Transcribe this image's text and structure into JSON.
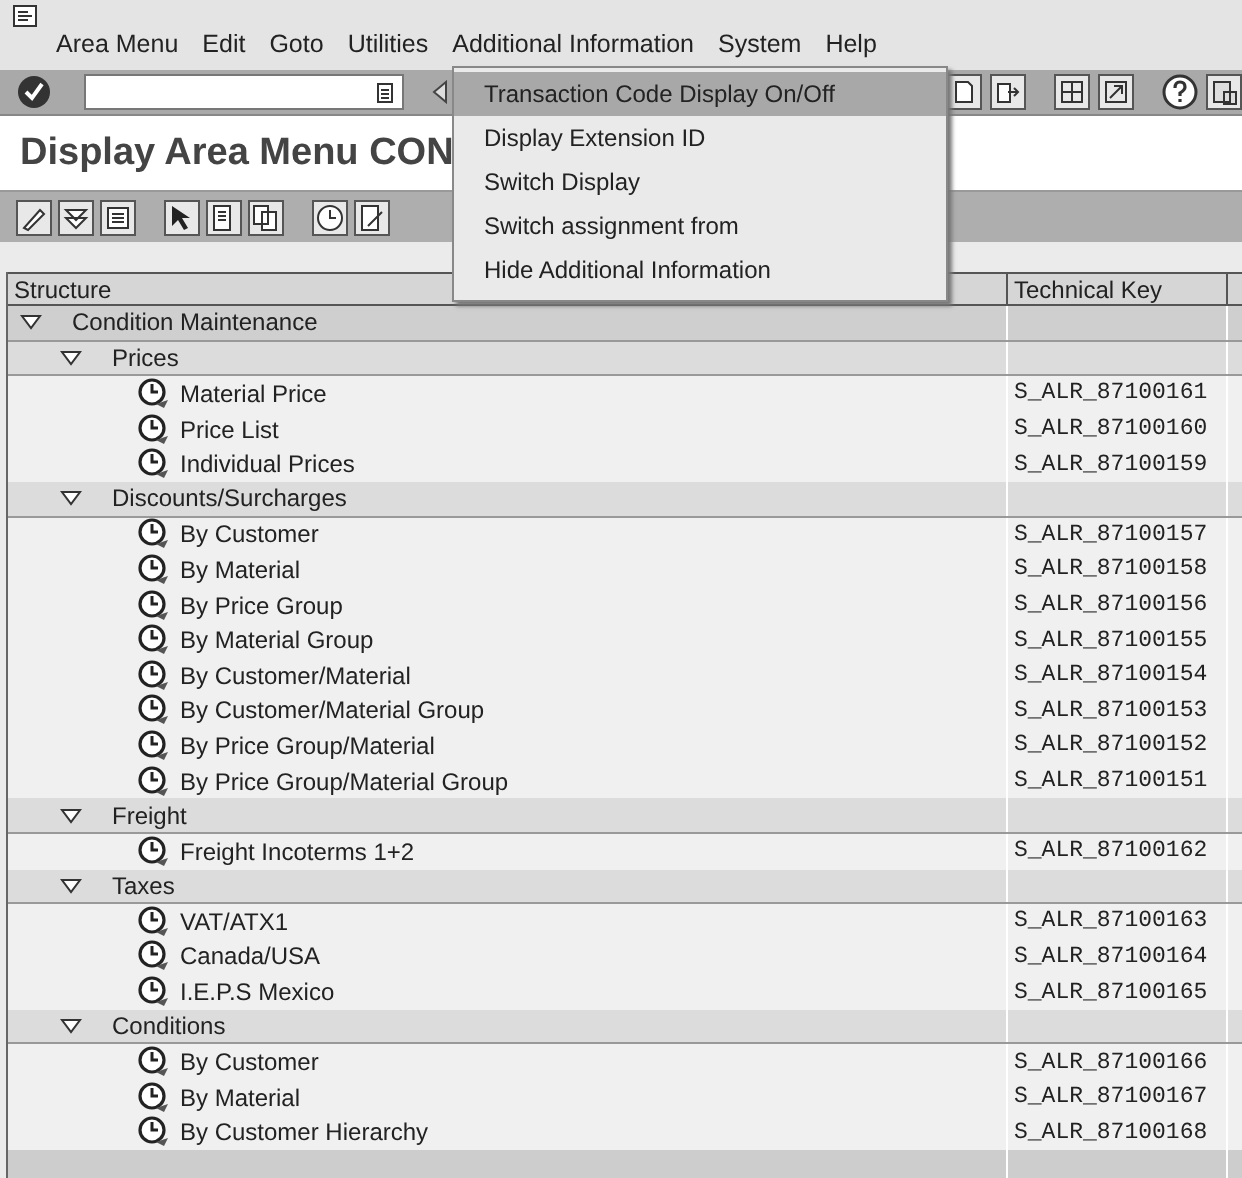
{
  "menu_bar": {
    "items": [
      {
        "label": "Area Menu"
      },
      {
        "label": "Edit"
      },
      {
        "label": "Goto"
      },
      {
        "label": "Utilities"
      },
      {
        "label": "Additional Information"
      },
      {
        "label": "System"
      },
      {
        "label": "Help"
      }
    ]
  },
  "title": "Display Area Menu CON",
  "dropdown": {
    "items": [
      {
        "label": "Transaction Code Display On/Off",
        "selected": true
      },
      {
        "label": "Display Extension ID",
        "selected": false
      },
      {
        "label": "Switch Display",
        "selected": false
      },
      {
        "label": "Switch assignment from",
        "selected": false
      },
      {
        "label": "Hide Additional Information",
        "selected": false
      }
    ]
  },
  "table": {
    "columns": [
      "Structure",
      "Technical Key"
    ],
    "rows": [
      {
        "label": "Condition Maintenance",
        "expanded": true,
        "children": [
          {
            "label": "Prices",
            "expanded": true,
            "children": [
              {
                "label": "Material Price",
                "technical_key": "S_ALR_87100161"
              },
              {
                "label": "Price List",
                "technical_key": "S_ALR_87100160"
              },
              {
                "label": "Individual Prices",
                "technical_key": "S_ALR_87100159"
              }
            ]
          },
          {
            "label": "Discounts/Surcharges",
            "expanded": true,
            "children": [
              {
                "label": "By Customer",
                "technical_key": "S_ALR_87100157"
              },
              {
                "label": "By Material",
                "technical_key": "S_ALR_87100158"
              },
              {
                "label": "By Price Group",
                "technical_key": "S_ALR_87100156"
              },
              {
                "label": "By Material Group",
                "technical_key": "S_ALR_87100155"
              },
              {
                "label": "By Customer/Material",
                "technical_key": "S_ALR_87100154"
              },
              {
                "label": "By Customer/Material Group",
                "technical_key": "S_ALR_87100153"
              },
              {
                "label": "By Price Group/Material",
                "technical_key": "S_ALR_87100152"
              },
              {
                "label": "By Price Group/Material Group",
                "technical_key": "S_ALR_87100151"
              }
            ]
          },
          {
            "label": "Freight",
            "expanded": true,
            "children": [
              {
                "label": "Freight Incoterms 1+2",
                "technical_key": "S_ALR_87100162"
              }
            ]
          },
          {
            "label": "Taxes",
            "expanded": true,
            "children": [
              {
                "label": "VAT/ATX1",
                "technical_key": "S_ALR_87100163"
              },
              {
                "label": "Canada/USA",
                "technical_key": "S_ALR_87100164"
              },
              {
                "label": "I.E.P.S Mexico",
                "technical_key": "S_ALR_87100165"
              }
            ]
          },
          {
            "label": "Conditions",
            "expanded": true,
            "children": [
              {
                "label": "By Customer",
                "technical_key": "S_ALR_87100166"
              },
              {
                "label": "By Material",
                "technical_key": "S_ALR_87100167"
              },
              {
                "label": "By Customer Hierarchy",
                "technical_key": "S_ALR_87100168"
              }
            ]
          }
        ]
      }
    ]
  }
}
